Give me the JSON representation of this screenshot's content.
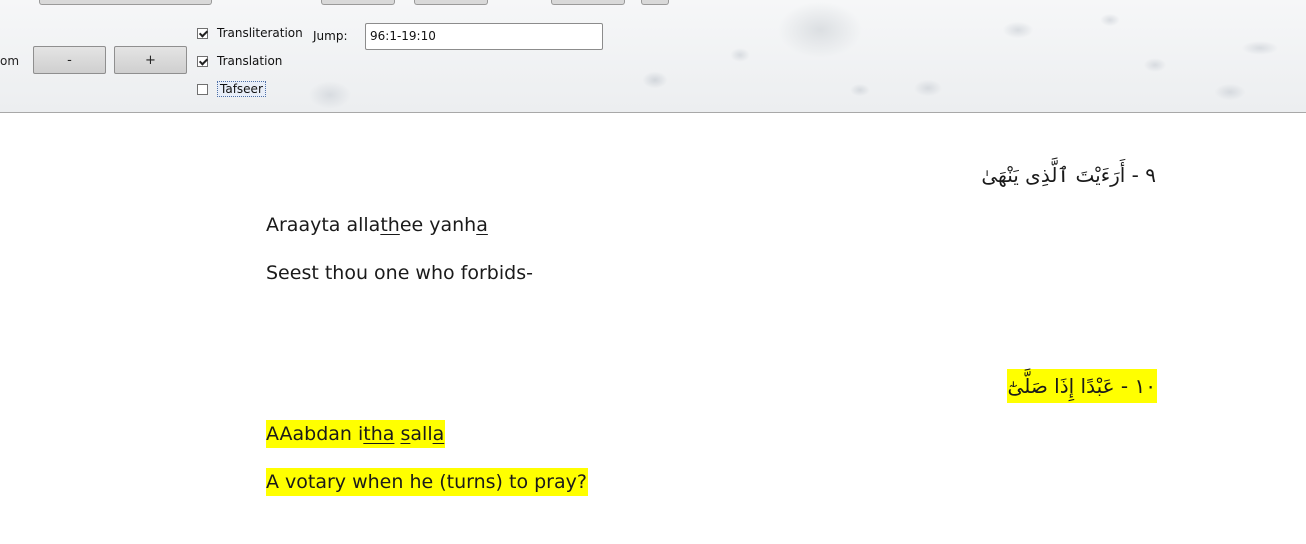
{
  "toolbar": {
    "zoom_label": "om",
    "zoom_out_label": "-",
    "zoom_in_label": "+",
    "options": [
      {
        "label": "Transliteration",
        "checked": true
      },
      {
        "label": "Translation",
        "checked": true
      },
      {
        "label": "Tafseer",
        "checked": false
      }
    ],
    "jump": {
      "label": "Jump:",
      "value": "96:1-19:10"
    }
  },
  "verses": [
    {
      "arabic": "٩ - أَرَءَيْتَ ٱلَّذِى يَنْهَىٰ",
      "transliteration": "Araayta allathee yanha",
      "translation": "Seest thou one who forbids-",
      "highlighted": false
    },
    {
      "arabic": "١٠ - عَبْدًا إِذَا صَلَّىٰٓ",
      "transliteration": "AAabdan itha salla",
      "translation": "A votary when he (turns) to pray?",
      "highlighted": true
    }
  ],
  "colors": {
    "highlight": "#ffff00",
    "toolbar_bg": "#eff1f2"
  }
}
